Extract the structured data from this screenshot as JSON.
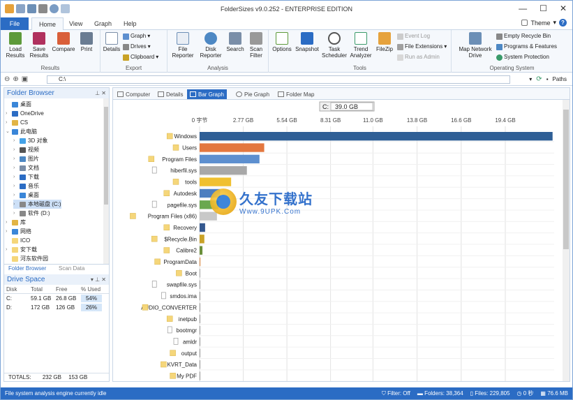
{
  "window": {
    "title": "FolderSizes v9.0.252 - ENTERPRISE EDITION",
    "min": "—",
    "max": "☐",
    "close": "✕"
  },
  "menu": {
    "file": "File",
    "tabs": [
      "Home",
      "View",
      "Graph",
      "Help"
    ],
    "theme": "Theme",
    "help_glyph": "?"
  },
  "ribbon": {
    "results": {
      "label": "Results",
      "load": "Load\nResults",
      "save": "Save\nResults",
      "compare": "Compare",
      "print": "Print"
    },
    "export": {
      "label": "Export",
      "details": "Details",
      "graph": "Graph",
      "drives": "Drives",
      "clipboard": "Clipboard"
    },
    "analysis": {
      "label": "Analysis",
      "file_reporter": "File\nReporter",
      "disk_reporter": "Disk\nReporter",
      "search": "Search",
      "scan_filter": "Scan\nFilter"
    },
    "tools": {
      "label": "Tools",
      "options": "Options",
      "snapshot": "Snapshot",
      "task_scheduler": "Task\nScheduler",
      "trend_analyzer": "Trend\nAnalyzer",
      "filezip": "FileZip",
      "event_log": "Event Log",
      "file_extensions": "File Extensions",
      "run_as_admin": "Run as Admin"
    },
    "system": {
      "label": "Operating System",
      "map_network_drive": "Map Network\nDrive",
      "empty_recycle_bin": "Empty Recycle Bin",
      "programs_features": "Programs & Features",
      "system_protection": "System Protection"
    }
  },
  "address": {
    "path": "C:\\",
    "paths_label": "Paths"
  },
  "folder_browser": {
    "title": "Folder Browser",
    "items": [
      {
        "label": "桌面",
        "depth": 0,
        "arrow": "",
        "color": "#3a86d8"
      },
      {
        "label": "OneDrive",
        "depth": 0,
        "arrow": "›",
        "color": "#2b6cc4"
      },
      {
        "label": "CS",
        "depth": 0,
        "arrow": "›",
        "color": "#e2b445"
      },
      {
        "label": "此电脑",
        "depth": 0,
        "arrow": "⌄",
        "color": "#3a86d8"
      },
      {
        "label": "3D 对象",
        "depth": 1,
        "arrow": "›",
        "color": "#45a3e8"
      },
      {
        "label": "视频",
        "depth": 1,
        "arrow": "›",
        "color": "#555"
      },
      {
        "label": "图片",
        "depth": 1,
        "arrow": "›",
        "color": "#4d88c4"
      },
      {
        "label": "文档",
        "depth": 1,
        "arrow": "›",
        "color": "#7a8ea8"
      },
      {
        "label": "下载",
        "depth": 1,
        "arrow": "›",
        "color": "#2b6cc4"
      },
      {
        "label": "音乐",
        "depth": 1,
        "arrow": "›",
        "color": "#2b6cc4"
      },
      {
        "label": "桌面",
        "depth": 1,
        "arrow": "›",
        "color": "#3a86d8"
      },
      {
        "label": "本地磁盘 (C:)",
        "depth": 1,
        "arrow": "›",
        "color": "#888",
        "selected": true
      },
      {
        "label": "软件 (D:)",
        "depth": 1,
        "arrow": "›",
        "color": "#888"
      },
      {
        "label": "库",
        "depth": 0,
        "arrow": "›",
        "color": "#e2b445"
      },
      {
        "label": "网络",
        "depth": 0,
        "arrow": "›",
        "color": "#3a86d8"
      },
      {
        "label": "ICO",
        "depth": 0,
        "arrow": "",
        "color": "#f5d67a"
      },
      {
        "label": "安下载",
        "depth": 0,
        "arrow": "›",
        "color": "#f5d67a"
      },
      {
        "label": "河东软件园",
        "depth": 0,
        "arrow": "",
        "color": "#f5d67a"
      }
    ],
    "tabs": [
      "Folder Browser",
      "Scan Data"
    ]
  },
  "drive_space": {
    "title": "Drive Space",
    "headers": [
      "Disk",
      "Total",
      "Free",
      "% Used"
    ],
    "rows": [
      {
        "disk": "C:",
        "total": "59.1 GB",
        "free": "26.8 GB",
        "used": "54%",
        "used_value": 54
      },
      {
        "disk": "D:",
        "total": "172 GB",
        "free": "126 GB",
        "used": "26%",
        "used_value": 26
      }
    ],
    "totals": {
      "label": "TOTALS:",
      "total": "232 GB",
      "free": "153 GB"
    }
  },
  "view_tabs": [
    "Computer",
    "Details",
    "Bar Graph",
    "Pie Graph",
    "Folder Map"
  ],
  "chart_data": {
    "type": "bar",
    "orientation": "horizontal",
    "title": "C:",
    "title_value": "39.0 GB",
    "x_ticks": [
      "0 字节",
      "2.77 GB",
      "5.54 GB",
      "8.31 GB",
      "11.0 GB",
      "13.8 GB",
      "16.6 GB",
      "19.4 GB"
    ],
    "x_tick_values": [
      0,
      2.77,
      5.54,
      8.31,
      11.0,
      13.8,
      16.6,
      19.4
    ],
    "xlim": [
      0,
      22.5
    ],
    "grid": true,
    "categories": [
      "Windows",
      "Users",
      "Program Files",
      "hiberfil.sys",
      "tools",
      "Autodesk",
      "pagefile.sys",
      "Program Files (x86)",
      "Recovery",
      "$Recycle.Bin",
      "Calibre2",
      "ProgramData",
      "Boot",
      "swapfile.sys",
      "smdos.ima",
      "AUDIO_CONVERTER",
      "inetpub",
      "bootmgr",
      "amldr",
      "output",
      "KVRT_Data",
      "My PDF"
    ],
    "kinds": [
      "folder",
      "folder",
      "folder",
      "file",
      "folder",
      "folder",
      "file",
      "folder",
      "folder",
      "folder",
      "folder",
      "folder",
      "folder",
      "file",
      "file",
      "folder",
      "folder",
      "file",
      "file",
      "folder",
      "folder",
      "folder"
    ],
    "values": [
      22.4,
      4.1,
      3.8,
      3.0,
      2.0,
      1.3,
      1.2,
      1.1,
      0.35,
      0.3,
      0.18,
      0.05,
      0.03,
      0.02,
      0.01,
      0.01,
      0.005,
      0.003,
      0.002,
      0.002,
      0.001,
      0.001
    ],
    "colors": [
      "#2f5f96",
      "#e3773f",
      "#5d8fcf",
      "#a8a8a8",
      "#f0c030",
      "#4d7fc0",
      "#6aa84f",
      "#c8c8c8",
      "#34588f",
      "#c9a227",
      "#6a8f3a",
      "#d98c4a",
      "#aaaaaa",
      "#999999",
      "#999999",
      "#999999",
      "#999999",
      "#999999",
      "#999999",
      "#999999",
      "#999999",
      "#999999"
    ]
  },
  "status": {
    "text": "File system analysis engine currently idle",
    "filter": "Filter: Off",
    "folders": "Folders: 38,364",
    "files": "Files: 229,805",
    "time": "0 秒",
    "memory": "76.6 MB"
  },
  "watermark": {
    "cn": "久友下载站",
    "url": "Www.9UPK.Com"
  }
}
